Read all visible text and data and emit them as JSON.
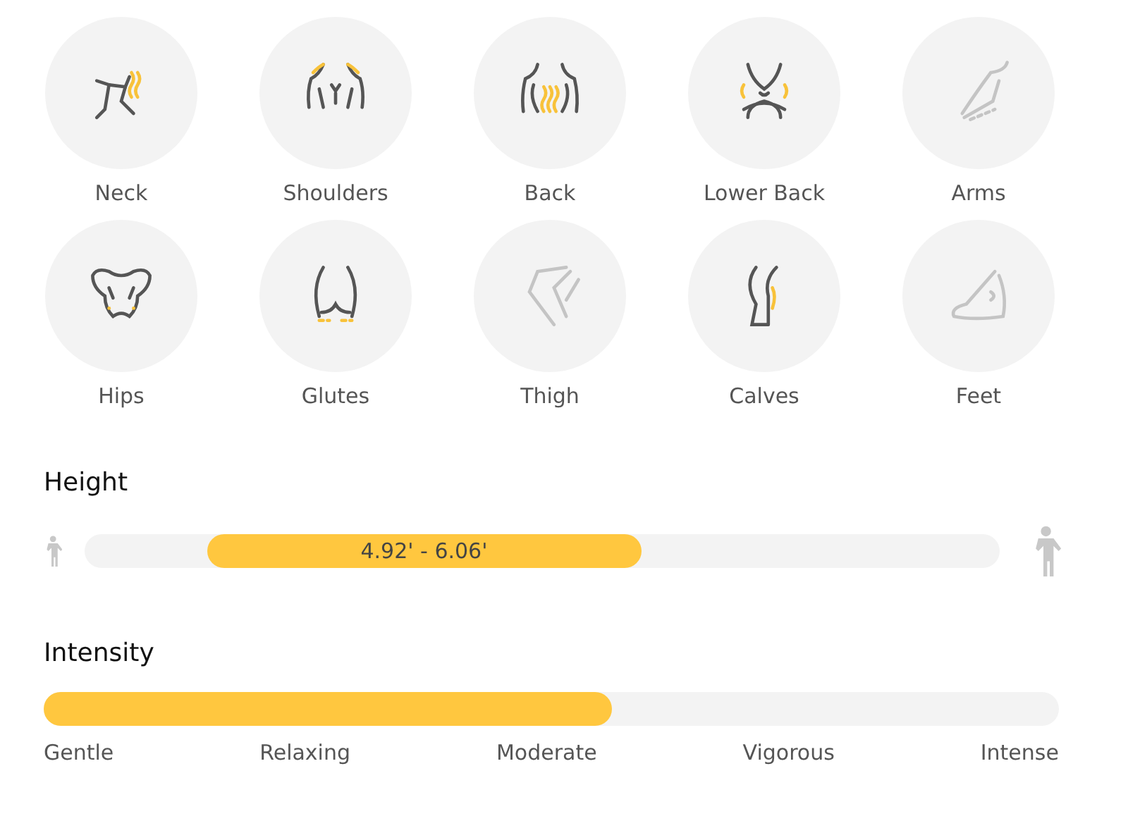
{
  "areas": [
    {
      "label": "Neck",
      "kind": "neck",
      "selected": true
    },
    {
      "label": "Shoulders",
      "kind": "shoulders",
      "selected": true
    },
    {
      "label": "Back",
      "kind": "back",
      "selected": true
    },
    {
      "label": "Lower Back",
      "kind": "lowerback",
      "selected": true
    },
    {
      "label": "Arms",
      "kind": "arms",
      "selected": false
    },
    {
      "label": "Hips",
      "kind": "hips",
      "selected": true
    },
    {
      "label": "Glutes",
      "kind": "glutes",
      "selected": true
    },
    {
      "label": "Thigh",
      "kind": "thigh",
      "selected": false
    },
    {
      "label": "Calves",
      "kind": "calves",
      "selected": true
    },
    {
      "label": "Feet",
      "kind": "feet",
      "selected": false
    }
  ],
  "height": {
    "title": "Height",
    "range_label": "4.92' - 6.06'"
  },
  "intensity": {
    "title": "Intensity",
    "level": 0.56,
    "labels": [
      "Gentle",
      "Relaxing",
      "Moderate",
      "Vigorous",
      "Intense"
    ]
  }
}
